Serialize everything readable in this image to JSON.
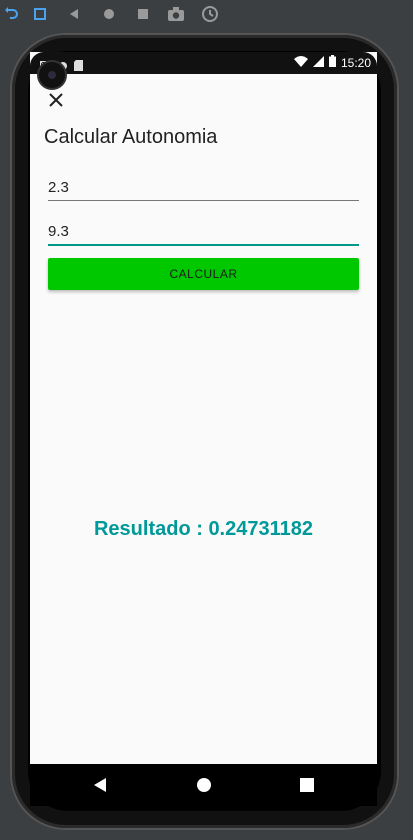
{
  "emulator": {
    "toolbar_icons": [
      "rotate-left-icon",
      "rotate-right-icon",
      "back-icon",
      "home-icon",
      "overview-icon",
      "camera-icon",
      "history-icon"
    ]
  },
  "status_bar": {
    "time": "15:20",
    "icons": [
      "gmail-icon",
      "circle-icon",
      "sd-card-icon",
      "wifi-icon",
      "signal-icon",
      "battery-icon"
    ]
  },
  "app": {
    "close_icon": "close-icon",
    "title": "Calcular Autonomia",
    "input1_value": "2.3",
    "input2_value": "9.3",
    "button_label": "CALCULAR",
    "result_text": "Resultado : 0.24731182",
    "colors": {
      "button": "#00c800",
      "result": "#009999",
      "focus_underline": "#009688"
    }
  },
  "nav_bar": {
    "icons": [
      "nav-back-icon",
      "nav-home-icon",
      "nav-recents-icon"
    ]
  }
}
